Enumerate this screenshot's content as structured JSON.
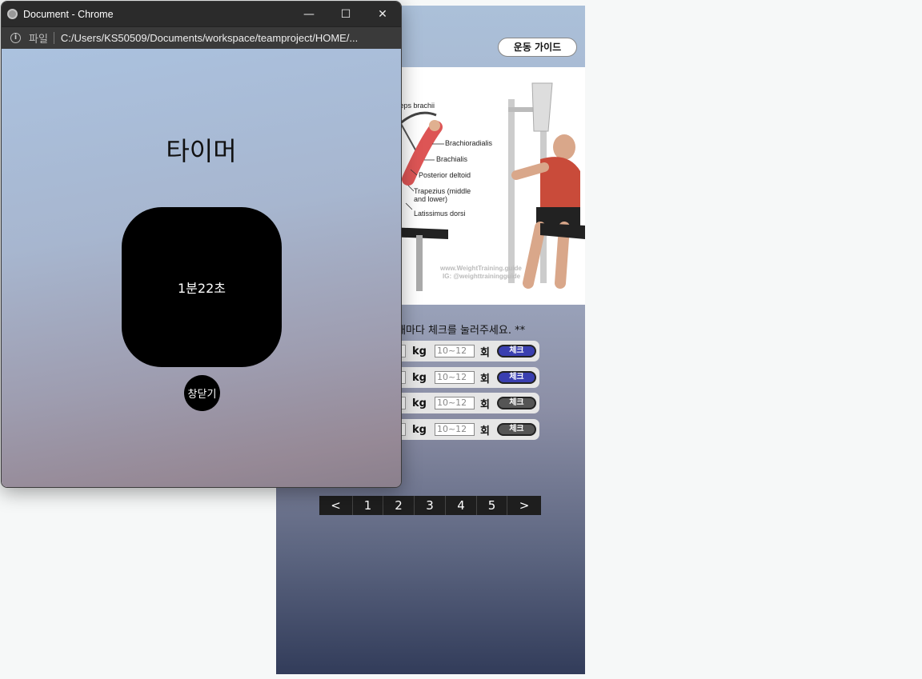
{
  "popup": {
    "window_title": "Document - Chrome",
    "address_bar": {
      "file_label": "파일",
      "url": "C:/Users/KS50509/Documents/workspace/teamproject/HOME/..."
    },
    "controls": {
      "minimize": "—",
      "maximize": "☐",
      "close": "✕"
    },
    "heading": "타이머",
    "timer_value": "1분22초",
    "close_button_label": "창닫기"
  },
  "page": {
    "guide_button_label": "운동 가이드",
    "image_labels": {
      "biceps": "ceps brachii",
      "brachioradialis": "Brachioradialis",
      "brachialis": "Brachialis",
      "posterior_deltoid": "Posterior deltoid",
      "trapezius_1": "Trapezius (middle",
      "trapezius_2": "and lower)",
      "latissimus": "Latissimus dorsi",
      "watermark_1": "www.WeightTraining.guide",
      "watermark_2": "IG: @weighttrainingguide"
    },
    "instruction": "때마다 체크를 눌러주세요. **",
    "sets": [
      {
        "unit": "kg",
        "reps_placeholder": "10~12",
        "reps_unit": "회",
        "check_label": "체크",
        "checked": true
      },
      {
        "unit": "kg",
        "reps_placeholder": "10~12",
        "reps_unit": "회",
        "check_label": "체크",
        "checked": true
      },
      {
        "unit": "kg",
        "reps_placeholder": "10~12",
        "reps_unit": "회",
        "check_label": "체크",
        "checked": false
      },
      {
        "unit": "kg",
        "reps_placeholder": "10~12",
        "reps_unit": "회",
        "check_label": "체크",
        "checked": false
      }
    ],
    "pagination": [
      "<",
      "1",
      "2",
      "3",
      "4",
      "5",
      ">"
    ]
  }
}
